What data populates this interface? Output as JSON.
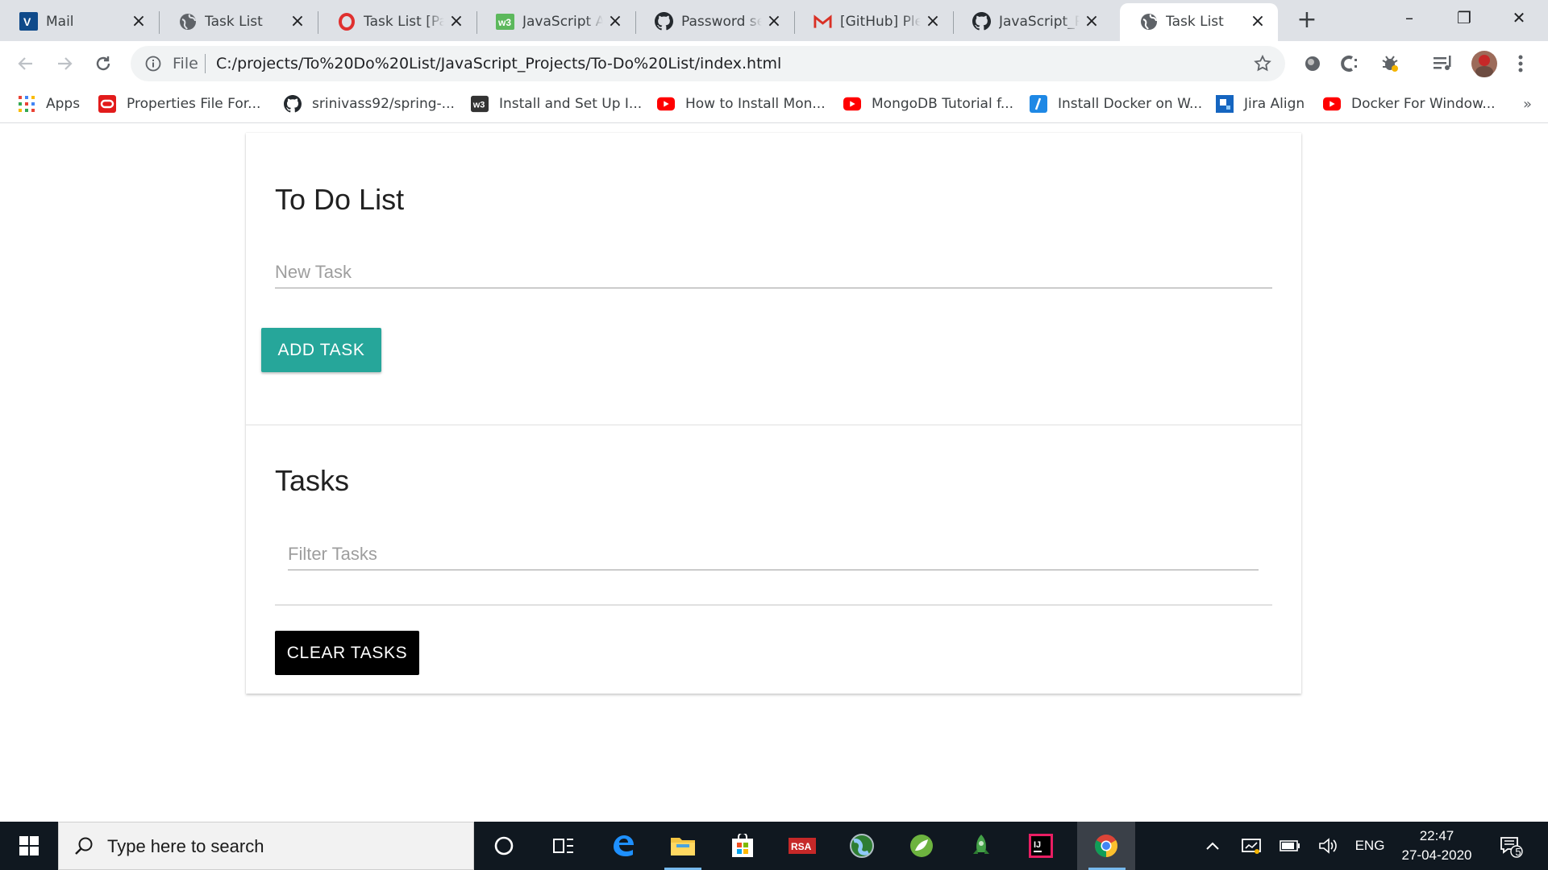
{
  "browser": {
    "tabs": [
      {
        "title": "Mail",
        "icon": "outlook-icon"
      },
      {
        "title": "Task List",
        "icon": "globe-icon"
      },
      {
        "title": "Task List [Par",
        "icon": "opera-icon"
      },
      {
        "title": "JavaScript Ar",
        "icon": "w3-icon"
      },
      {
        "title": "Password se",
        "icon": "github-icon"
      },
      {
        "title": "[GitHub] Ple",
        "icon": "gmail-icon"
      },
      {
        "title": "JavaScript_P",
        "icon": "github-icon"
      },
      {
        "title": "Task List",
        "icon": "globe-icon",
        "active": true
      }
    ],
    "window_controls": {
      "minimize": "–",
      "restore": "❐",
      "close": "✕"
    },
    "address_bar": {
      "scheme_label": "File",
      "url": "C:/projects/To%20Do%20List/JavaScript_Projects/To-Do%20List/index.html"
    },
    "bookmarks": [
      {
        "label": "Apps",
        "icon": "apps-grid-icon"
      },
      {
        "label": "Properties File For...",
        "icon": "oracle-icon"
      },
      {
        "label": "srinivass92/spring-...",
        "icon": "github-icon"
      },
      {
        "label": "Install and Set Up I...",
        "icon": "w3-icon"
      },
      {
        "label": "How to Install Mon...",
        "icon": "youtube-icon"
      },
      {
        "label": "MongoDB Tutorial f...",
        "icon": "youtube-icon"
      },
      {
        "label": "Install Docker on W...",
        "icon": "slash-icon"
      },
      {
        "label": "Jira Align",
        "icon": "jira-align-icon"
      },
      {
        "label": "Docker For Window...",
        "icon": "youtube-icon"
      }
    ],
    "bookmarks_overflow": "»"
  },
  "page": {
    "todo": {
      "title": "To Do List",
      "new_task_placeholder": "New Task",
      "add_button": "ADD TASK"
    },
    "tasks": {
      "title": "Tasks",
      "filter_placeholder": "Filter Tasks",
      "clear_button": "CLEAR TASKS"
    }
  },
  "taskbar": {
    "search_placeholder": "Type here to search",
    "language": "ENG",
    "time": "22:47",
    "date": "27-04-2020",
    "notification_count": "5",
    "colors": {
      "background": "#101820",
      "accent": "#26a69a"
    }
  }
}
